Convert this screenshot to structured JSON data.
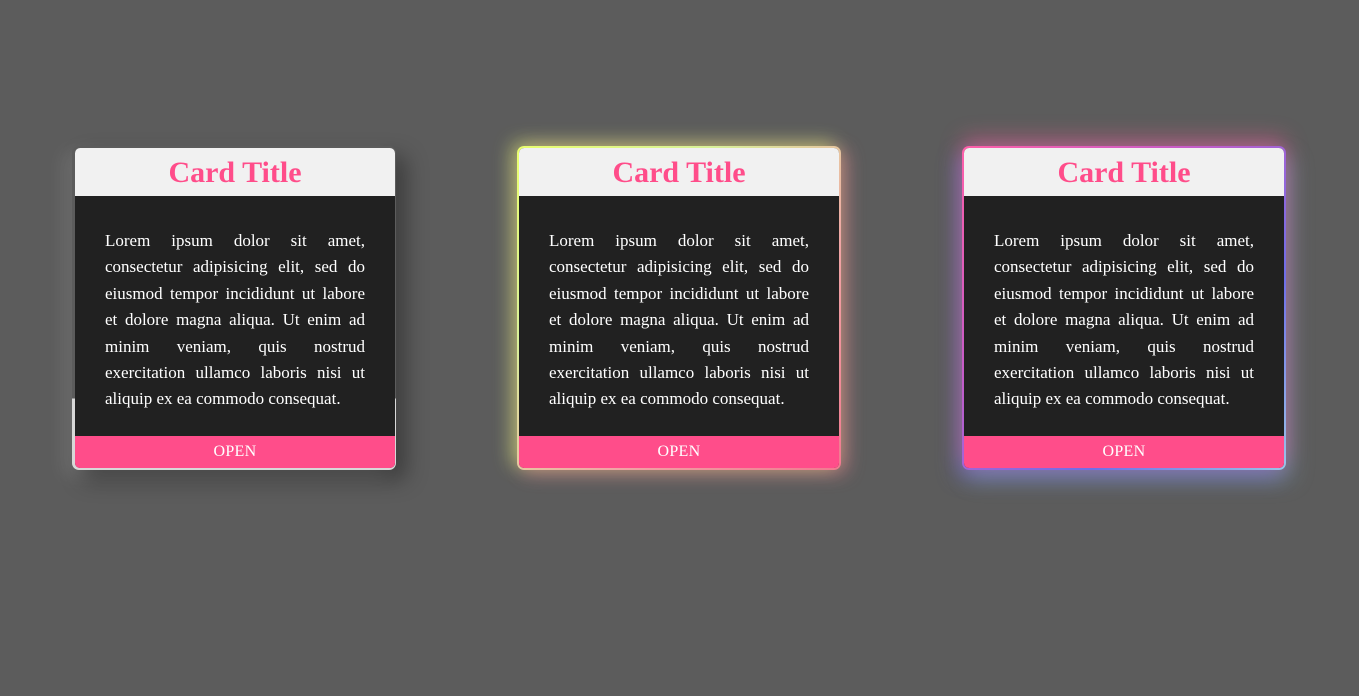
{
  "colors": {
    "background": "#5c5c5c",
    "card_header_bg": "#f1f1f1",
    "card_body_bg": "#212121",
    "accent": "#ff4d8a",
    "text": "#ffffff"
  },
  "cards": [
    {
      "title": "Card Title",
      "body": "Lorem ipsum dolor sit amet, consectetur adipisicing elit, sed do eiusmod tempor incididunt ut labore et dolore magna aliqua. Ut enim ad minim veniam, quis nostrud exercitation ullamco laboris nisi ut aliquip ex ea commodo consequat.",
      "button_label": "OPEN"
    },
    {
      "title": "Card Title",
      "body": "Lorem ipsum dolor sit amet, consectetur adipisicing elit, sed do eiusmod tempor incididunt ut labore et dolore magna aliqua. Ut enim ad minim veniam, quis nostrud exercitation ullamco laboris nisi ut aliquip ex ea commodo consequat.",
      "button_label": "OPEN"
    },
    {
      "title": "Card Title",
      "body": "Lorem ipsum dolor sit amet, consectetur adipisicing elit, sed do eiusmod tempor incididunt ut labore et dolore magna aliqua. Ut enim ad minim veniam, quis nostrud exercitation ullamco laboris nisi ut aliquip ex ea commodo consequat.",
      "button_label": "OPEN"
    }
  ]
}
